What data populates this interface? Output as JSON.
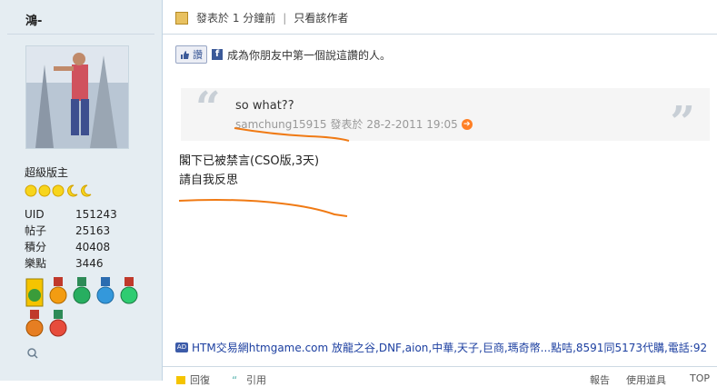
{
  "sidebar": {
    "username": "鴻-",
    "rank": "超級版主",
    "stats": [
      {
        "label": "UID",
        "value": "151243"
      },
      {
        "label": "帖子",
        "value": "25163"
      },
      {
        "label": "積分",
        "value": "40408"
      },
      {
        "label": "樂點",
        "value": "3446"
      }
    ]
  },
  "post": {
    "posted": "發表於 1 分鐘前",
    "only_author": "只看該作者",
    "like_label": "讚",
    "fb_text": "成為你朋友中第一個說這讚的人。",
    "quote": {
      "text": "so what??",
      "author": "samchung15915",
      "posted": "發表於 28-2-2011 19:05"
    },
    "body_lines": [
      "閣下已被禁言(CSO版,3天)",
      "請自我反思"
    ],
    "ad": "HTM交易網htmgame.com 放龍之谷,DNF,aion,中華,天子,巨商,瑪奇幣...點咭,8591同5173代購,電話:92"
  },
  "footer": {
    "reply": "回復",
    "quote": "引用",
    "report": "報告",
    "use_item": "使用道具",
    "top": "TOP"
  },
  "colors": {
    "sidebar_bg": "#e5edf2",
    "annotation": "#f07a14",
    "link": "#1c3fa0"
  }
}
